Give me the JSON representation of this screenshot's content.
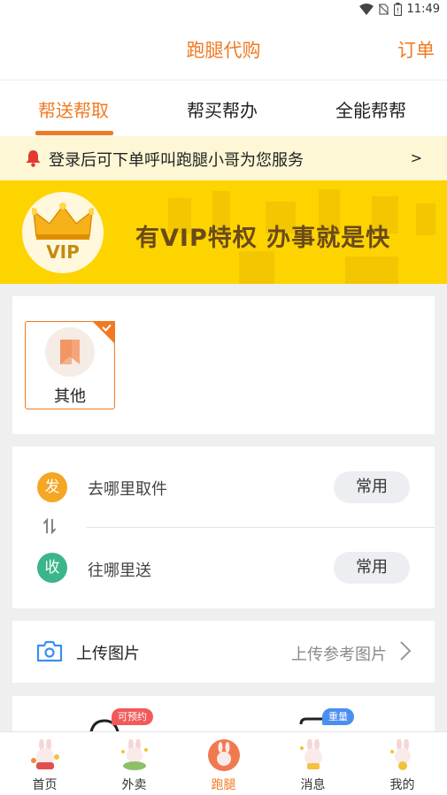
{
  "status_bar": {
    "time": "11:49"
  },
  "header": {
    "title": "跑腿代购",
    "orders": "订单"
  },
  "tabs": [
    {
      "label": "帮送帮取",
      "active": true
    },
    {
      "label": "帮买帮办",
      "active": false
    },
    {
      "label": "全能帮帮",
      "active": false
    }
  ],
  "notice": {
    "text": "登录后可下单呼叫跑腿小哥为您服务",
    "arrow": ">"
  },
  "vip_banner": {
    "badge_label": "VIP",
    "slogan": "有VIP特权  办事就是快"
  },
  "categories": [
    {
      "label": "其他",
      "selected": true
    }
  ],
  "address": {
    "pickup": {
      "dot": "发",
      "placeholder": "去哪里取件",
      "button": "常用",
      "color": "#f5a623"
    },
    "dropoff": {
      "dot": "收",
      "placeholder": "往哪里送",
      "button": "常用",
      "color": "#3bb58a"
    }
  },
  "upload": {
    "label": "上传图片",
    "hint": "上传参考图片"
  },
  "services": [
    {
      "badge": "可预约",
      "badge_color": "#f25a5a"
    },
    {
      "badge": "重量",
      "badge_color": "#4a8ff0"
    }
  ],
  "bottom_nav": [
    {
      "label": "首页",
      "icon": "home-rabbit-icon",
      "active": false
    },
    {
      "label": "外卖",
      "icon": "takeout-rabbit-icon",
      "active": false
    },
    {
      "label": "跑腿",
      "icon": "errand-rabbit-icon",
      "active": true
    },
    {
      "label": "消息",
      "icon": "message-rabbit-icon",
      "active": false
    },
    {
      "label": "我的",
      "icon": "profile-rabbit-icon",
      "active": false
    }
  ],
  "colors": {
    "accent": "#f07a22",
    "vip_yellow": "#fdd400",
    "notice_bg": "#fdf7d6"
  }
}
